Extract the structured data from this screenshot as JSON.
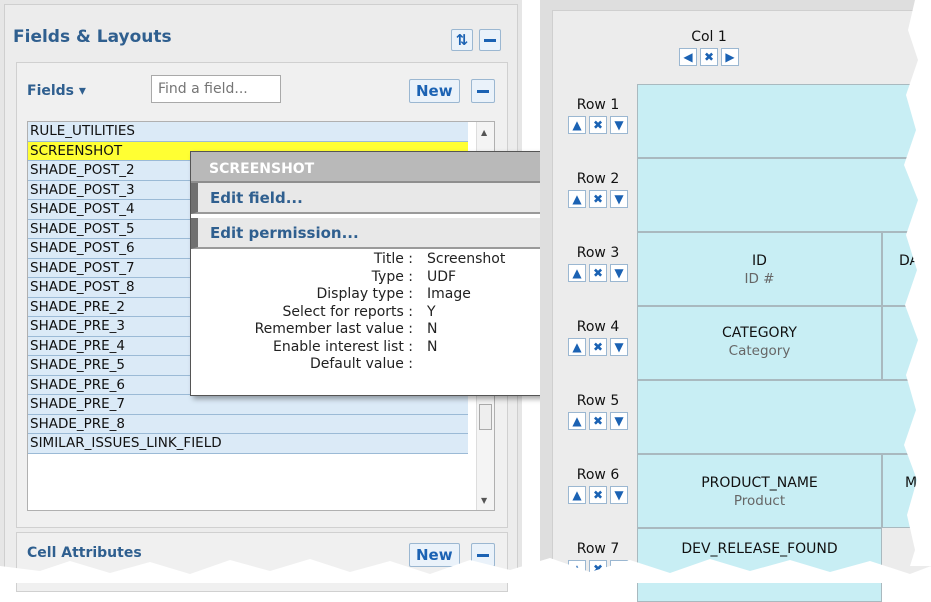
{
  "panel": {
    "title": "Fields & Layouts",
    "fields_label": "Fields ▾",
    "search_placeholder": "Find a field...",
    "new_label": "New",
    "cell_attributes_label": "Cell Attributes",
    "field_list": [
      "RULE_UTILITIES",
      "SCREENSHOT",
      "SHADE_POST_2",
      "SHADE_POST_3",
      "SHADE_POST_4",
      "SHADE_POST_5",
      "SHADE_POST_6",
      "SHADE_POST_7",
      "SHADE_POST_8",
      "SHADE_PRE_2",
      "SHADE_PRE_3",
      "SHADE_PRE_4",
      "SHADE_PRE_5",
      "SHADE_PRE_6",
      "SHADE_PRE_7",
      "SHADE_PRE_8",
      "SIMILAR_ISSUES_LINK_FIELD"
    ]
  },
  "popup": {
    "title": "SCREENSHOT",
    "edit_field": "Edit field...",
    "edit_permission": "Edit permission...",
    "properties": [
      {
        "key": "Title :",
        "value": "Screenshot"
      },
      {
        "key": "Type :",
        "value": "UDF"
      },
      {
        "key": "Display type :",
        "value": "Image"
      },
      {
        "key": "Select for reports :",
        "value": "Y"
      },
      {
        "key": "Remember last value :",
        "value": "N"
      },
      {
        "key": "Enable interest list :",
        "value": "N"
      },
      {
        "key": "Default value :",
        "value": ""
      }
    ]
  },
  "grid": {
    "col_label": "Col 1",
    "rows": [
      "Row 1",
      "Row 2",
      "Row 3",
      "Row 4",
      "Row 5",
      "Row 6",
      "Row 7"
    ],
    "cells": [
      {
        "name": "ID",
        "label": "ID #"
      },
      {
        "name": "DAT",
        "label": ""
      },
      {
        "name": "CATEGORY",
        "label": "Category"
      },
      {
        "name": "PRODUCT_NAME",
        "label": "Product"
      },
      {
        "name": "MO",
        "label": ""
      },
      {
        "name": "DEV_RELEASE_FOUND",
        "label": ""
      }
    ]
  }
}
